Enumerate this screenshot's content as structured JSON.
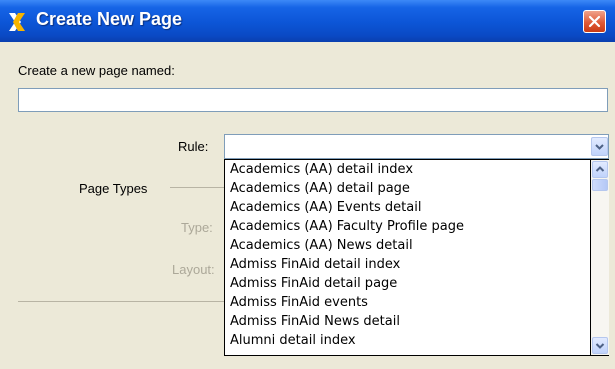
{
  "window": {
    "title": "Create New Page"
  },
  "form": {
    "page_name_label": "Create a new page named:",
    "page_name_value": "",
    "rule_label": "Rule:",
    "rule_value": "",
    "page_types_label": "Page Types",
    "type_label": "Type:",
    "layout_label": "Layout:"
  },
  "rule_options": [
    "Academics (AA) detail index",
    "Academics (AA) detail page",
    "Academics (AA) Events detail",
    "Academics (AA) Faculty Profile page",
    "Academics (AA) News detail",
    "Admiss FinAid detail index",
    "Admiss FinAid detail page",
    "Admiss FinAid events",
    "Admiss FinAid News detail",
    "Alumni detail index"
  ],
  "icons": {
    "app": "app-logo-icon",
    "close": "close-icon",
    "dropdown": "chevron-down-icon",
    "scroll_up": "chevron-up-icon",
    "scroll_down": "chevron-down-icon"
  },
  "colors": {
    "titlebar": "#0c55d6",
    "close_button": "#df5a37",
    "dialog_background": "#ece9d8",
    "disabled_text": "#aca899",
    "field_border": "#7f9db9"
  }
}
